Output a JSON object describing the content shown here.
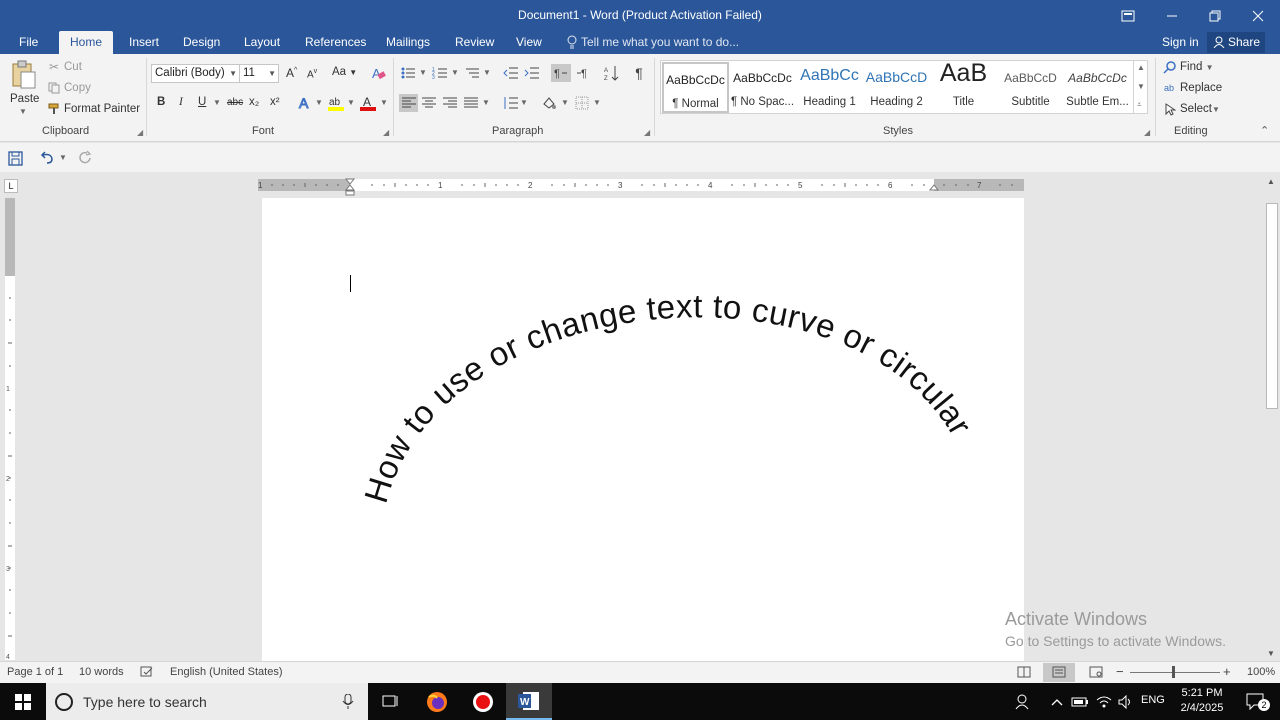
{
  "window": {
    "title": "Document1 - Word (Product Activation Failed)",
    "accent": "#2b579a"
  },
  "tabs": [
    {
      "label": "File"
    },
    {
      "label": "Home"
    },
    {
      "label": "Insert"
    },
    {
      "label": "Design"
    },
    {
      "label": "Layout"
    },
    {
      "label": "References"
    },
    {
      "label": "Mailings"
    },
    {
      "label": "Review"
    },
    {
      "label": "View"
    }
  ],
  "tellme": {
    "placeholder": "Tell me what you want to do..."
  },
  "account": {
    "signin": "Sign in",
    "share": "Share"
  },
  "clipboard": {
    "paste": "Paste",
    "cut": "Cut",
    "copy": "Copy",
    "format_painter": "Format Painter",
    "label": "Clipboard"
  },
  "font": {
    "name": "Calibri (Body)",
    "size": "11",
    "change_case": "Aa",
    "bold": "B",
    "italic": "I",
    "underline": "U",
    "strike": "abc",
    "subscript": "x₂",
    "superscript": "x²",
    "label": "Font",
    "highlight_color": "#ffff00",
    "font_color": "#e01010"
  },
  "paragraph": {
    "label": "Paragraph"
  },
  "styles": {
    "items": [
      {
        "sample": "AaBbCcDc",
        "name": "¶ Normal"
      },
      {
        "sample": "AaBbCcDc",
        "name": "¶ No Spac..."
      },
      {
        "sample": "AaBbCc",
        "name": "Heading 1"
      },
      {
        "sample": "AaBbCcD",
        "name": "Heading 2"
      },
      {
        "sample": "AaB",
        "name": "Title"
      },
      {
        "sample": "AaBbCcD",
        "name": "Subtitle"
      },
      {
        "sample": "AaBbCcDc",
        "name": "Subtle Em..."
      }
    ],
    "label": "Styles"
  },
  "editing": {
    "find": "Find",
    "replace": "Replace",
    "select": "Select",
    "label": "Editing"
  },
  "ruler": {
    "numbers": [
      "1",
      "1",
      "2",
      "3",
      "4",
      "5",
      "6",
      "7"
    ]
  },
  "document": {
    "curved_text": "How to use or change text to curve or circular"
  },
  "watermark": {
    "line1": "Activate Windows",
    "line2": "Go to Settings to activate Windows."
  },
  "status": {
    "page": "Page 1 of 1",
    "words": "10 words",
    "language": "English (United States)",
    "zoom": "100%"
  },
  "taskbar": {
    "search_placeholder": "Type here to search",
    "language": "ENG",
    "time": "5:21 PM",
    "date": "2/4/2025",
    "notifications": "2"
  }
}
